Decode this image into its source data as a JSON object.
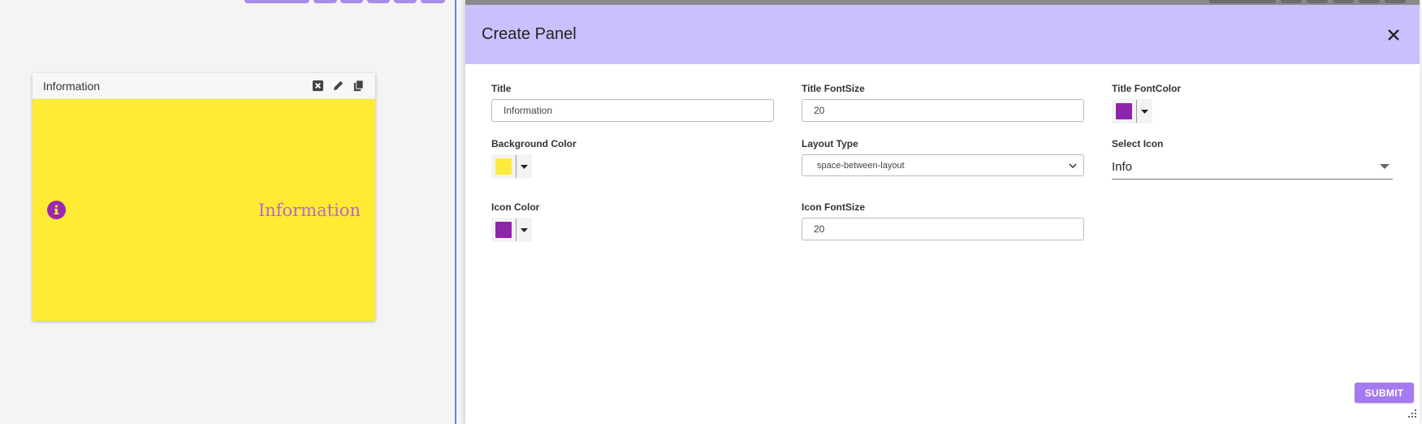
{
  "widget": {
    "header_title": "Information",
    "body_title": "Information",
    "background_color": "#ffeb33",
    "icon_color": "#9c27b0",
    "title_color": "#b06ad0",
    "tools": [
      "clear-icon",
      "edit-icon",
      "copy-icon"
    ]
  },
  "panel": {
    "title": "Create Panel",
    "header_color": "#cbc0fd",
    "fields": {
      "title": {
        "label": "Title",
        "value": "Information"
      },
      "title_fontsize": {
        "label": "Title FontSize",
        "value": "20"
      },
      "title_fontcolor": {
        "label": "Title FontColor",
        "color": "#8e24aa"
      },
      "background_color": {
        "label": "Background Color",
        "color": "#ffeb3b"
      },
      "layout_type": {
        "label": "Layout Type",
        "value": "space-between-layout"
      },
      "select_icon": {
        "label": "Select Icon",
        "value": "Info"
      },
      "icon_color": {
        "label": "Icon Color",
        "color": "#8e24aa"
      },
      "icon_fontsize": {
        "label": "Icon FontSize",
        "value": "20"
      }
    },
    "submit_label": "SUBMIT"
  }
}
